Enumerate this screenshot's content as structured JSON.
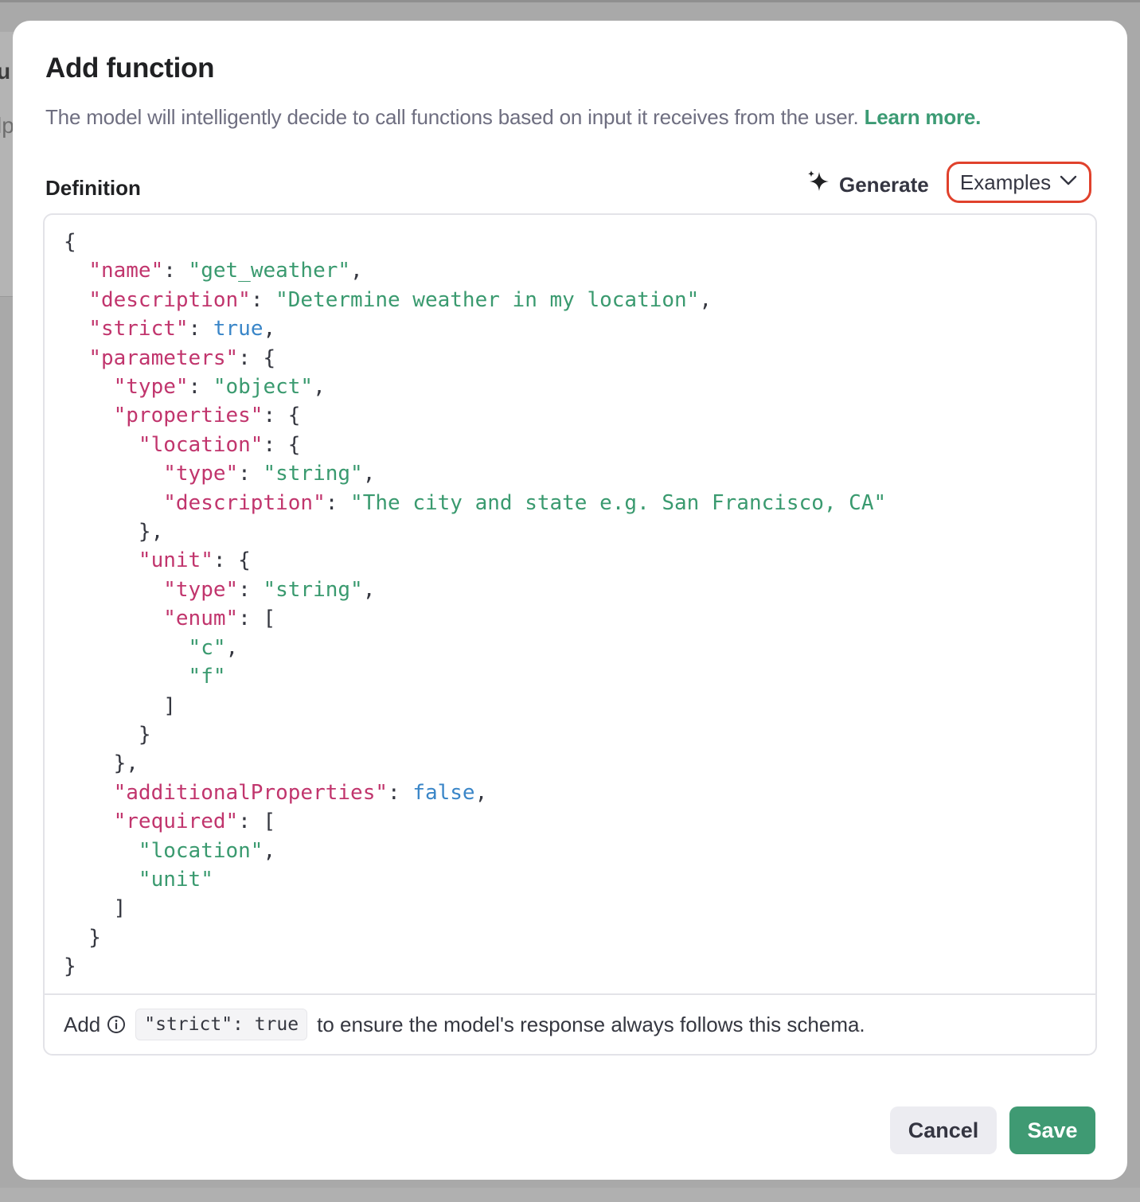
{
  "background": {
    "partial_text_1": "u",
    "partial_text_2": "lp"
  },
  "modal": {
    "title": "Add function",
    "description": "The model will intelligently decide to call functions based on input it receives from the user.",
    "learn_more": "Learn more.",
    "definition_label": "Definition",
    "generate_label": "Generate",
    "examples_label": "Examples",
    "definition_code": "{\n  \"name\": \"get_weather\",\n  \"description\": \"Determine weather in my location\",\n  \"strict\": true,\n  \"parameters\": {\n    \"type\": \"object\",\n    \"properties\": {\n      \"location\": {\n        \"type\": \"string\",\n        \"description\": \"The city and state e.g. San Francisco, CA\"\n      },\n      \"unit\": {\n        \"type\": \"string\",\n        \"enum\": [\n          \"c\",\n          \"f\"\n        ]\n      }\n    },\n    \"additionalProperties\": false,\n    \"required\": [\n      \"location\",\n      \"unit\"\n    ]\n  }\n}",
    "hint_prefix": "Add",
    "hint_code": "\"strict\": true",
    "hint_suffix": "to ensure the model's response always follows this schema.",
    "cancel_label": "Cancel",
    "save_label": "Save"
  },
  "colors": {
    "accent_green": "#3f9a73",
    "link_green": "#3c9b74",
    "highlight_red": "#e0412c",
    "json_key": "#c1356d",
    "json_string": "#3a9a6f",
    "json_boolean": "#3a86c8"
  },
  "icons": {
    "generate": "sparkle-icon",
    "examples": "chevron-down-icon",
    "hint": "info-icon"
  }
}
